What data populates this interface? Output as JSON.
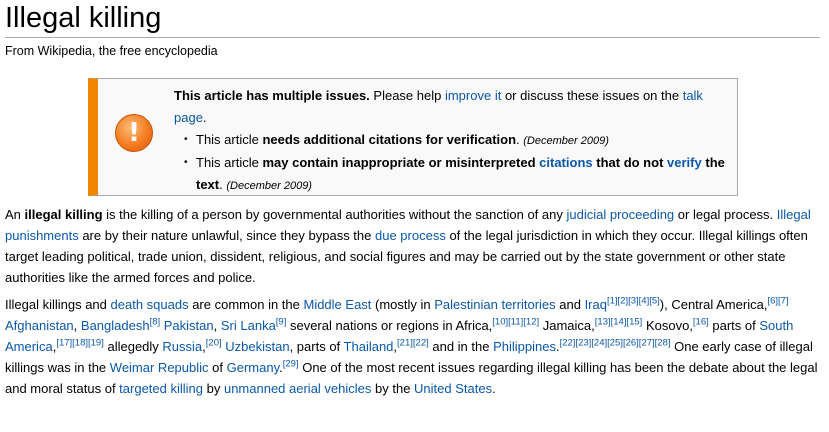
{
  "title": "Illegal killing",
  "subtitle": "From Wikipedia, the free encyclopedia",
  "colors": {
    "link": "#0b58a8",
    "ambox_border": "#f28500",
    "ambox_bg": "#f9f9f9"
  },
  "icons": {
    "ambox": "exclamation-circle-icon"
  },
  "ambox": {
    "icon_glyph": "!",
    "lead_bold": "This article has multiple issues.",
    "lead_mid": " Please help ",
    "improve_link": "improve it",
    "lead_tail": " or discuss these issues on the ",
    "talk_link": "talk page",
    "lead_end": ".",
    "bullet": "•",
    "issue1_pre": "This article ",
    "issue1_bold": "needs additional citations for verification",
    "issue1_punct": ".",
    "issue1_date": "(December 2009)",
    "issue2_pre": "This article ",
    "issue2_bold": "may contain inappropriate or misinterpreted",
    "issue2_link": "citations",
    "issue2_bold2": "that do not",
    "issue2_link2": "verify",
    "issue2_bold3": "the text",
    "issue2_punct": ".",
    "issue2_date": "(December 2009)"
  },
  "p1": {
    "t1": "An ",
    "b1": "illegal killing",
    "t2": " is the killing of a person by governmental authorities without the sanction of any ",
    "l1": "judicial proceeding",
    "t3": " or legal process. ",
    "l2": "Illegal punishments",
    "t4": " are by their nature unlawful, since they bypass the ",
    "l3": "due process",
    "t5": " of the legal jurisdiction in which they occur. Illegal killings often target leading political, trade union, dissident, religious, and social figures and may be carried out by the state government or other state authorities like the armed forces and police."
  },
  "p2": {
    "t1": "Illegal killings and ",
    "l_death_squads": "death squads",
    "t2": " are common in the ",
    "l_middle_east": "Middle East",
    "t3": " (mostly in ",
    "l_palestinian": "Palestinian territories",
    "t4": " and ",
    "l_iraq": "Iraq",
    "c_iraq": "[1][2][3][4][5]",
    "t5": "), Central America,",
    "c_ca": "[6][7]",
    "t6": " ",
    "l_afghanistan": "Afghanistan",
    "t7": ", ",
    "l_bangladesh": "Bangladesh",
    "c_bangladesh": "[8]",
    "t8": " ",
    "l_pakistan": "Pakistan",
    "t9": ", ",
    "l_srilanka": "Sri Lanka",
    "c_srilanka": "[9]",
    "t10": " several nations or regions in Africa,",
    "c_africa": "[10][11][12]",
    "t11": " Jamaica,",
    "c_jamaica": "[13][14][15]",
    "t12": " Kosovo,",
    "c_kosovo": "[16]",
    "t13": " parts of ",
    "l_southamerica": "South America",
    "t14": ",",
    "c_southamerica": "[17][18][19]",
    "t15": " allegedly ",
    "l_russia": "Russia",
    "t16": ",",
    "c_russia": "[20]",
    "t17": " ",
    "l_uzbekistan": "Uzbekistan",
    "t18": ", parts of ",
    "l_thailand": "Thailand",
    "t19": ",",
    "c_thailand": "[21][22]",
    "t20": " and in the ",
    "l_philippines": "Philippines",
    "t21": ".",
    "c_philippines": "[22][23][24][25][26][27][28]",
    "t22": " One early case of illegal killings was in the ",
    "l_weimar": "Weimar Republic",
    "t23": " of ",
    "l_germany": "Germany",
    "t24": ".",
    "c_germany": "[29]",
    "t25": " One of the most recent issues regarding illegal killing has been the debate about the legal and moral status of ",
    "l_targeted": "targeted killing",
    "t26": " by ",
    "l_unmanned": "unmanned aerial vehicles",
    "t27": " by the ",
    "l_us": "United States",
    "t28": "."
  }
}
